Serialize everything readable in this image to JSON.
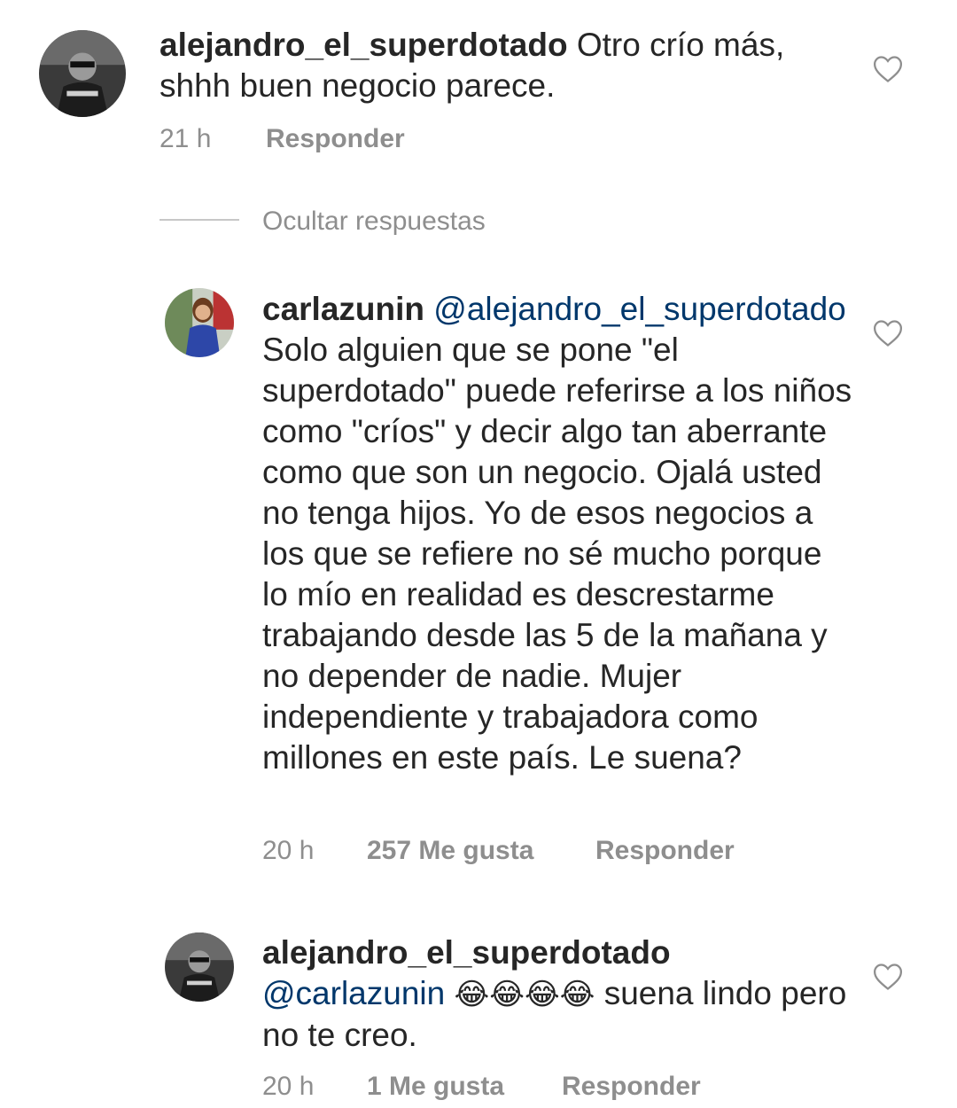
{
  "comments": [
    {
      "username": "alejandro_el_superdotado",
      "text_lines": [
        "Otro crío más,",
        "shhh buen negocio parece."
      ],
      "time": "21 h",
      "reply_label": "Responder",
      "avatar_icon": "avatar-man-sunglasses"
    },
    {
      "username": "carlazunin",
      "mention": "@alejandro_el_superdotado",
      "text": "Solo alguien que se pone \"el superdotado\" puede referirse a los niños como \"críos\" y decir algo tan aberrante como que son un negocio. Ojalá usted no tenga hijos. Yo de esos negocios a los que se refiere no sé mucho porque lo mío en realidad es descrestarme trabajando desde las 5 de la mañana y no depender de nadie. Mujer independiente y trabajadora como millones en este país. Le suena?",
      "time": "20 h",
      "likes": "257 Me gusta",
      "reply_label": "Responder",
      "avatar_icon": "avatar-woman-blue-dress"
    },
    {
      "username": "alejandro_el_superdotado",
      "mention": "@carlazunin",
      "emojis": "😂😂😂😂",
      "text": "suena lindo pero no te creo.",
      "time": "20 h",
      "likes": "1 Me gusta",
      "reply_label": "Responder",
      "avatar_icon": "avatar-man-sunglasses"
    }
  ],
  "hide_replies_label": "Ocultar respuestas",
  "like_icon": "heart-outline-icon",
  "colors": {
    "text": "#262626",
    "meta": "#8e8e8e",
    "mention": "#00376b"
  }
}
